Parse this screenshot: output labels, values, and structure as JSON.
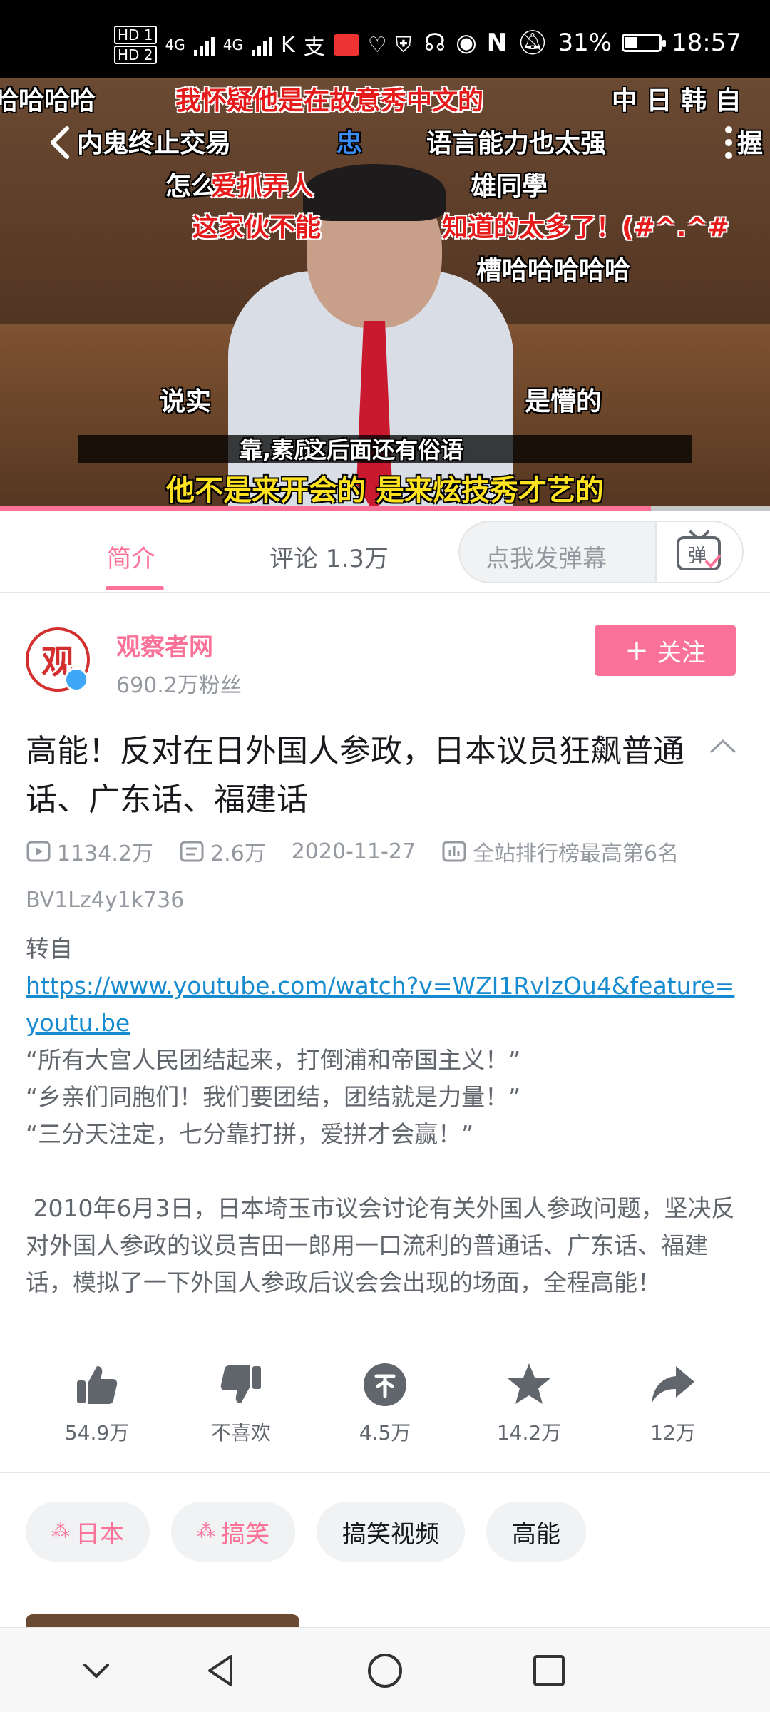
{
  "status_bar": {
    "hd1": "HD 1",
    "hd2": "HD 2",
    "net1": "4G",
    "net2": "4G",
    "battery_text": "31%",
    "battery_level": 0.31,
    "time": "18:57"
  },
  "video": {
    "progress": 0.845,
    "danmaku": [
      "哈哈哈哈",
      "我怀疑他是在故意秀中文的",
      "中 日 韩 自",
      "内鬼终止交易",
      "忠",
      "语言能力也太强",
      "握",
      "怎么",
      "爱抓弄人",
      "雄同學",
      "这家伙不能",
      "知道的太多了！(#^.^#",
      "槽哈哈哈哈哈",
      "说实",
      "是懵的",
      "靠,素质",
      "这后面还有俗语"
    ],
    "subtitle": "他不是来开会的  是来炫技秀才艺的"
  },
  "tabs": {
    "intro": "简介",
    "comments": "评论 1.3万",
    "danmu_placeholder": "点我发弹幕",
    "danmu_button": "弹"
  },
  "uploader": {
    "avatar_text": "观",
    "name": "观察者网",
    "fans": "690.2万粉丝",
    "follow_label": "关注"
  },
  "video_info": {
    "title": "高能！反对在日外国人参政，日本议员狂飙普通话、广东话、福建话",
    "views": "1134.2万",
    "danmaku_count": "2.6万",
    "date": "2020-11-27",
    "rank": "全站排行榜最高第6名",
    "bvid": "BV1Lz4y1k736",
    "repost_label": "转自",
    "source_url": "https://www.youtube.com/watch?v=WZI1RvIzOu4&feature=youtu.be",
    "quotes": [
      "“所有大宫人民团结起来，打倒浦和帝国主义！”",
      "“乡亲们同胞们！我们要团结，团结就是力量！”",
      "“三分天注定，七分靠打拼，爱拼才会赢！”"
    ],
    "description": " 2010年6月3日，日本埼玉市议会讨论有关外国人参政问题，坚决反对外国人参政的议员吉田一郎用一口流利的普通话、广东话、福建话，模拟了一下外国人参政后议会会出现的场面，全程高能！"
  },
  "actions": {
    "like": "54.9万",
    "dislike": "不喜欢",
    "coin": "4.5万",
    "favorite": "14.2万",
    "share": "12万"
  },
  "tags": [
    {
      "label": "日本",
      "hot": true
    },
    {
      "label": "搞笑",
      "hot": true
    },
    {
      "label": "搞笑视频",
      "hot": false
    },
    {
      "label": "高能",
      "hot": false
    }
  ],
  "colors": {
    "accent": "#fb7299",
    "link": "#178bcf",
    "subtitle": "#ffe21f"
  }
}
